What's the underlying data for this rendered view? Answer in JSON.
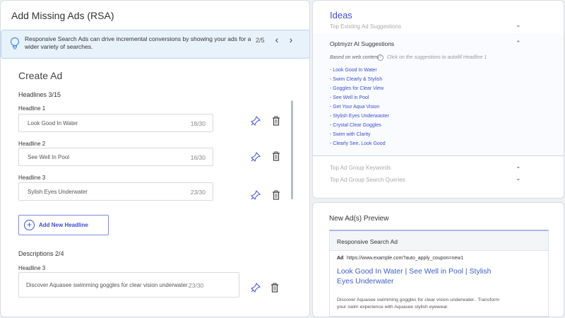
{
  "left_panel": {
    "title": "Add Missing Ads (RSA)",
    "banner": {
      "message": "Responsive Search Ads can drive incremental conversions by showing your ads for a wider variety of searches.",
      "pager": "2/5",
      "prev_icon": "chevron-left-icon",
      "next_icon": "chevron-right-icon"
    },
    "create_title": "Create Ad",
    "headlines_label": "Headlines 3/15",
    "headlines": [
      {
        "label": "Headline 1",
        "value": "Look Good In Water",
        "count": "18/30"
      },
      {
        "label": "Headline 2",
        "value": "See Well In Pool",
        "count": "16/30"
      },
      {
        "label": "Headline 3",
        "value": "Sylish Eyes Underwater",
        "count": "23/30"
      }
    ],
    "add_headline_label": "Add New Headline",
    "descriptions_label": "Descriptions 2/4",
    "description": {
      "label": "Headline 3",
      "value": "Discover Aquasee swimming goggles for clear vision underwater.",
      "count": "23/30"
    }
  },
  "ideas_panel": {
    "title": "Ideas",
    "top_existing": "Top Existing Ad Suggestions",
    "ai_title": "Optmyzr AI Suggestions",
    "ai_basis": "Based on web content",
    "ai_help": "Click on the suggestions to autofill Headline 1",
    "suggestions": [
      "- Look Good In Water",
      "- Swim Clearly & Stylish",
      "- Goggles for Clear View",
      "- See Well in Pool",
      "- Get Your Aqua Vision",
      "- Stylish Eyes Underwaster",
      "- Crystal Clear Goggles",
      "- Swim with Clarity",
      "- Clearly See, Look Good"
    ],
    "keywords": "Top Ad Group Keywords",
    "queries": "Top Ad Group Search Queries"
  },
  "preview_panel": {
    "title": "New Ad(s) Preview",
    "card_title": "Responsive Search Ad",
    "badge": "Ad",
    "url": "https://www.example.com?auto_apply_coupon=new1",
    "headline": "Look Good In Water | See Well in Pool | Stylish Eyes Underwater",
    "description": "Discover Aquasee swimming goggles for clear vision underwater.. Transform your swim experience with Aquasee stylish eyewear."
  },
  "colors": {
    "accent": "#3f4fc9",
    "banner_bg": "#e8f2fb",
    "link": "#3b5fc6"
  }
}
